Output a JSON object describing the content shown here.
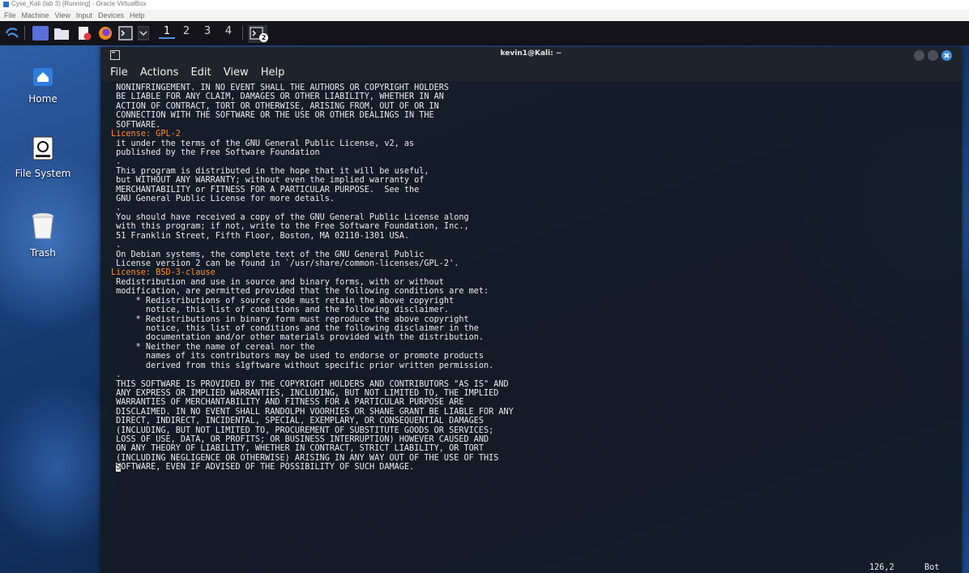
{
  "vbox": {
    "window_title": "Cyse_Kali (lab 3) [Running] - Oracle VirtualBox",
    "menu": [
      "File",
      "Machine",
      "View",
      "Input",
      "Devices",
      "Help"
    ]
  },
  "panel": {
    "workspaces": [
      "1",
      "2",
      "3",
      "4"
    ],
    "active_workspace": "1",
    "terminal_badge": "2"
  },
  "desktop": {
    "icons": [
      {
        "label": "Home",
        "icon": "home-icon"
      },
      {
        "label": "File System",
        "icon": "drive-icon"
      },
      {
        "label": "Trash",
        "icon": "trash-icon"
      }
    ]
  },
  "terminal": {
    "title": "kevin1@Kali: ~",
    "menu": [
      "File",
      "Actions",
      "Edit",
      "View",
      "Help"
    ],
    "lines": [
      " NONINFRINGEMENT. IN NO EVENT SHALL THE AUTHORS OR COPYRIGHT HOLDERS",
      " BE LIABLE FOR ANY CLAIM, DAMAGES OR OTHER LIABILITY, WHETHER IN AN",
      " ACTION OF CONTRACT, TORT OR OTHERWISE, ARISING FROM, OUT OF OR IN",
      " CONNECTION WITH THE SOFTWARE OR THE USE OR OTHER DEALINGS IN THE",
      " SOFTWARE.",
      "",
      "License: GPL-2",
      " it under the terms of the GNU General Public License, v2, as",
      " published by the Free Software Foundation",
      " .",
      " This program is distributed in the hope that it will be useful,",
      " but WITHOUT ANY WARRANTY; without even the implied warranty of",
      " MERCHANTABILITY or FITNESS FOR A PARTICULAR PURPOSE.  See the",
      " GNU General Public License for more details.",
      " .",
      " You should have received a copy of the GNU General Public License along",
      " with this program; if not, write to the Free Software Foundation, Inc.,",
      " 51 Franklin Street, Fifth Floor, Boston, MA 02110-1301 USA.",
      " .",
      " On Debian systems, the complete text of the GNU General Public",
      " License version 2 can be found in `/usr/share/common-licenses/GPL-2'.",
      "",
      "License: BSD-3-clause",
      " Redistribution and use in source and binary forms, with or without",
      " modification, are permitted provided that the following conditions are met:",
      "     * Redistributions of source code must retain the above copyright",
      "       notice, this list of conditions and the following disclaimer.",
      "     * Redistributions in binary form must reproduce the above copyright",
      "       notice, this list of conditions and the following disclaimer in the",
      "       documentation and/or other materials provided with the distribution.",
      "     * Neither the name of cereal nor the",
      "       names of its contributors may be used to endorse or promote products",
      "       derived from this s1gftware without specific prior written permission.",
      " .",
      " THIS SOFTWARE IS PROVIDED BY THE COPYRIGHT HOLDERS AND CONTRIBUTORS \"AS IS\" AND",
      " ANY EXPRESS OR IMPLIED WARRANTIES, INCLUDING, BUT NOT LIMITED TO, THE IMPLIED",
      " WARRANTIES OF MERCHANTABILITY AND FITNESS FOR A PARTICULAR PURPOSE ARE",
      " DISCLAIMED. IN NO EVENT SHALL RANDOLPH VOORHIES OR SHANE GRANT BE LIABLE FOR ANY",
      " DIRECT, INDIRECT, INCIDENTAL, SPECIAL, EXEMPLARY, OR CONSEQUENTIAL DAMAGES",
      " (INCLUDING, BUT NOT LIMITED TO, PROCUREMENT OF SUBSTITUTE GOODS OR SERVICES;",
      " LOSS OF USE, DATA, OR PROFITS; OR BUSINESS INTERRUPTION) HOWEVER CAUSED AND",
      " ON ANY THEORY OF LIABILITY, WHETHER IN CONTRACT, STRICT LIABILITY, OR TORT",
      " (INCLUDING NEGLIGENCE OR OTHERWISE) ARISING IN ANY WAY OUT OF THE USE OF THIS",
      " SOFTWARE, EVEN IF ADVISED OF THE POSSIBILITY OF SUCH DAMAGE."
    ],
    "status_position": "126,2",
    "status_scroll": "Bot"
  },
  "colors": {
    "license_label": "#ff8c2a",
    "workspace_active": "#4b8cdc",
    "close_button": "#3d8ee0"
  }
}
